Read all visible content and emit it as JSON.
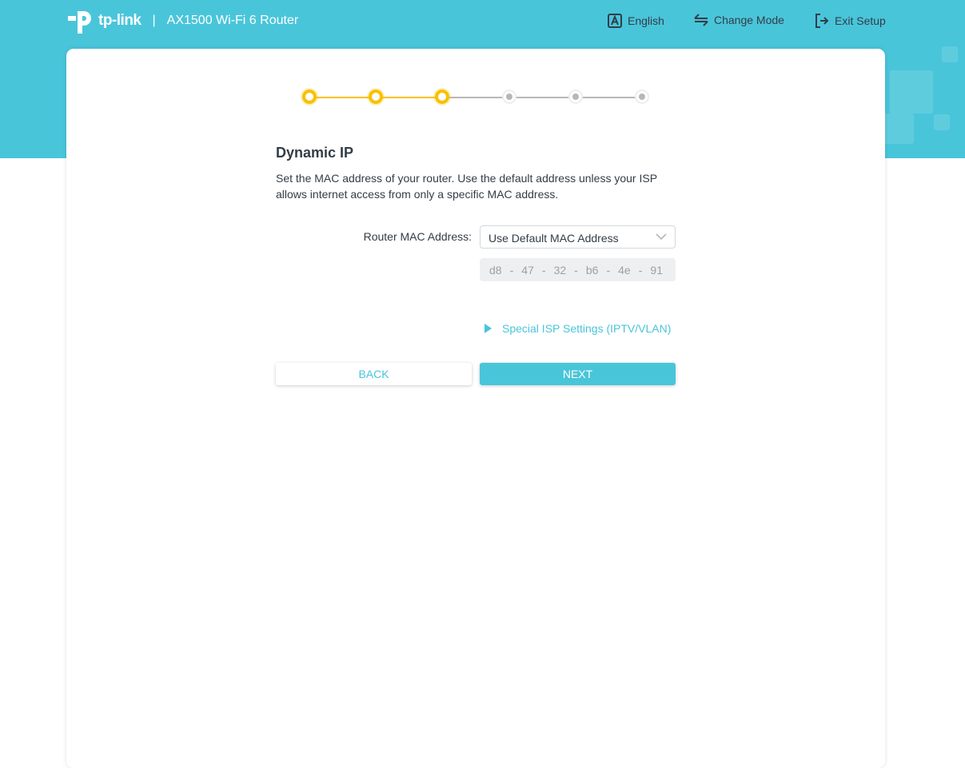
{
  "header": {
    "brand": "tp-link",
    "separator": "|",
    "model": "AX1500 Wi-Fi 6 Router",
    "nav": [
      {
        "label": "English",
        "icon": "language-icon"
      },
      {
        "label": "Change Mode",
        "icon": "swap-icon"
      },
      {
        "label": "Exit Setup",
        "icon": "exit-icon"
      }
    ]
  },
  "stepper": {
    "total_steps": 6,
    "completed_steps": 3,
    "active_color": "#f8c100",
    "inactive_color": "#b5b7ba"
  },
  "main": {
    "title": "Dynamic IP",
    "description": "Set the MAC address of your router. Use the default address unless your ISP allows internet access from only a specific MAC address.",
    "mac_label": "Router MAC Address:",
    "mac_select": "Use Default MAC Address",
    "mac_octets": [
      "d8",
      "47",
      "32",
      "b6",
      "4e",
      "91"
    ],
    "mac_separator": "-",
    "isp_link": "Special ISP Settings (IPTV/VLAN)",
    "back_label": "BACK",
    "next_label": "NEXT"
  },
  "colors": {
    "brand": "#49c5da"
  }
}
